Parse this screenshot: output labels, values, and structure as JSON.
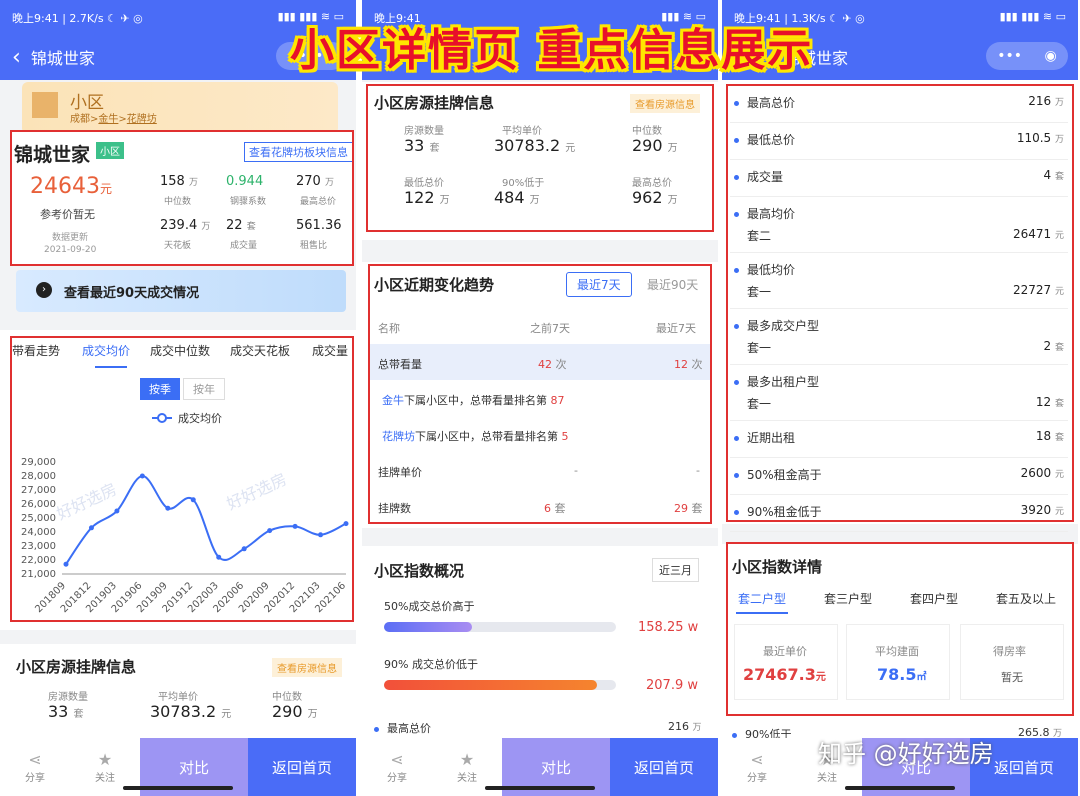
{
  "status": {
    "time": "晚上9:41",
    "speed1": "2.7K/s",
    "speed3": "1.3K/s",
    "battery": "100"
  },
  "nav": {
    "title": "锦城世家",
    "title_partial": "锦城世家"
  },
  "banner": "小区详情页 重点信息展示",
  "community": {
    "type_label": "小区",
    "path_city": "成都",
    "path_area": "金牛",
    "path_sub": "花牌坊",
    "name": "锦城世家",
    "badge": "小区",
    "link": "查看花牌坊板块信息",
    "price": "24643",
    "price_unit": "元",
    "ref_label": "参考价",
    "ref_value": "暂无",
    "update_label": "数据更新",
    "update_date": "2021-09-20",
    "stats": [
      {
        "v": "158",
        "u": "万",
        "l": "中位数"
      },
      {
        "v": "0.944",
        "u": "",
        "l": "钢骤系数"
      },
      {
        "v": "270",
        "u": "万",
        "l": "最高总价"
      },
      {
        "v": "239.4",
        "u": "万",
        "l": "天花板"
      },
      {
        "v": "22",
        "u": "套",
        "l": "成交量"
      },
      {
        "v": "561.36",
        "u": "",
        "l": "租售比"
      }
    ]
  },
  "deal_banner": "查看最近90天成交情况",
  "chart_tabs": [
    "带看走势",
    "成交均价",
    "成交中位数",
    "成交天花板",
    "成交量"
  ],
  "chart_toggle": [
    "按季",
    "按年"
  ],
  "chart_data": {
    "type": "line",
    "title": "",
    "legend": "成交均价",
    "categories": [
      "201809",
      "201812",
      "201903",
      "201906",
      "201909",
      "201912",
      "202003",
      "202006",
      "202009",
      "202012",
      "202103",
      "202106"
    ],
    "series": [
      {
        "name": "成交均价",
        "values": [
          21700,
          24300,
          25500,
          28000,
          25700,
          26300,
          22200,
          22800,
          24100,
          24400,
          23800,
          24600
        ]
      }
    ],
    "ylim": [
      21000,
      29000
    ],
    "yticks": [
      "21,000",
      "22,000",
      "23,000",
      "24,000",
      "25,000",
      "26,000",
      "27,000",
      "28,000",
      "29,000"
    ],
    "watermark": "好好选房"
  },
  "listing": {
    "title": "小区房源挂牌信息",
    "link": "查看房源信息",
    "items": [
      {
        "l": "房源数量",
        "v": "33",
        "u": "套"
      },
      {
        "l": "平均单价",
        "v": "30783.2",
        "u": "元"
      },
      {
        "l": "中位数",
        "v": "290",
        "u": "万"
      },
      {
        "l": "最低总价",
        "v": "122",
        "u": "万"
      },
      {
        "l": "90%低于",
        "v": "484",
        "u": "万"
      },
      {
        "l": "最高总价",
        "v": "962",
        "u": "万"
      }
    ]
  },
  "trend": {
    "title": "小区近期变化趋势",
    "tab_active": "最近7天",
    "tab_other": "最近90天",
    "h_name": "名称",
    "h_prev": "之前7天",
    "h_last": "最近7天",
    "r1": {
      "name": "总带看量",
      "prev": "42",
      "prev_u": "次",
      "last": "12",
      "last_u": "次"
    },
    "r2": {
      "link": "金牛",
      "text": "下属小区中，总带看量排名第",
      "rank": "87"
    },
    "r3": {
      "link": "花牌坊",
      "text": "下属小区中，总带看量排名第",
      "rank": "5"
    },
    "r4": {
      "name": "挂牌单价",
      "prev": "-",
      "last": "-"
    },
    "r5": {
      "name": "挂牌数",
      "prev": "6",
      "prev_u": "套",
      "last": "29",
      "last_u": "套"
    }
  },
  "index": {
    "title": "小区指数概况",
    "period": "近三月",
    "b1_label": "50%成交总价高于",
    "b1_value": "158.25 w",
    "b1_fill": 0.38,
    "b2_label": "90% 成交总价低于",
    "b2_value": "207.9 w",
    "b2_fill": 0.92,
    "peek_label": "最高总价",
    "peek_value": "216",
    "peek_unit": "万"
  },
  "details": [
    {
      "l": "最高总价",
      "s": "",
      "v": "216",
      "u": "万"
    },
    {
      "l": "最低总价",
      "s": "",
      "v": "110.5",
      "u": "万"
    },
    {
      "l": "成交量",
      "s": "",
      "v": "4",
      "u": "套"
    },
    {
      "l": "最高均价",
      "s": "套二",
      "v": "26471",
      "u": "元"
    },
    {
      "l": "最低均价",
      "s": "套一",
      "v": "22727",
      "u": "元"
    },
    {
      "l": "最多成交户型",
      "s": "套一",
      "v": "2",
      "u": "套"
    },
    {
      "l": "最多出租户型",
      "s": "套一",
      "v": "12",
      "u": "套"
    },
    {
      "l": "近期出租",
      "s": "",
      "v": "18",
      "u": "套"
    },
    {
      "l": "50%租金高于",
      "s": "",
      "v": "2600",
      "u": "元"
    },
    {
      "l": "90%租金低于",
      "s": "",
      "v": "3920",
      "u": "元"
    }
  ],
  "idx_detail": {
    "title": "小区指数详情",
    "tabs": [
      "套二户型",
      "套三户型",
      "套四户型",
      "套五及以上"
    ],
    "c1_l": "最近单价",
    "c1_v": "27467.3",
    "c1_u": "元",
    "c2_l": "平均建面",
    "c2_v": "78.5",
    "c2_u": "㎡",
    "c3_l": "得房率",
    "c3_v": "暂无",
    "peek_l": "90%低于",
    "peek_v": "265.8",
    "peek_u": "万"
  },
  "bottom": {
    "share": "分享",
    "follow": "关注",
    "compare": "对比",
    "home": "返回首页"
  },
  "watermark": "知乎 @好好选房",
  "colors": {
    "accent": "#4a6cf7",
    "red": "#e03030",
    "green": "#2db36b"
  }
}
